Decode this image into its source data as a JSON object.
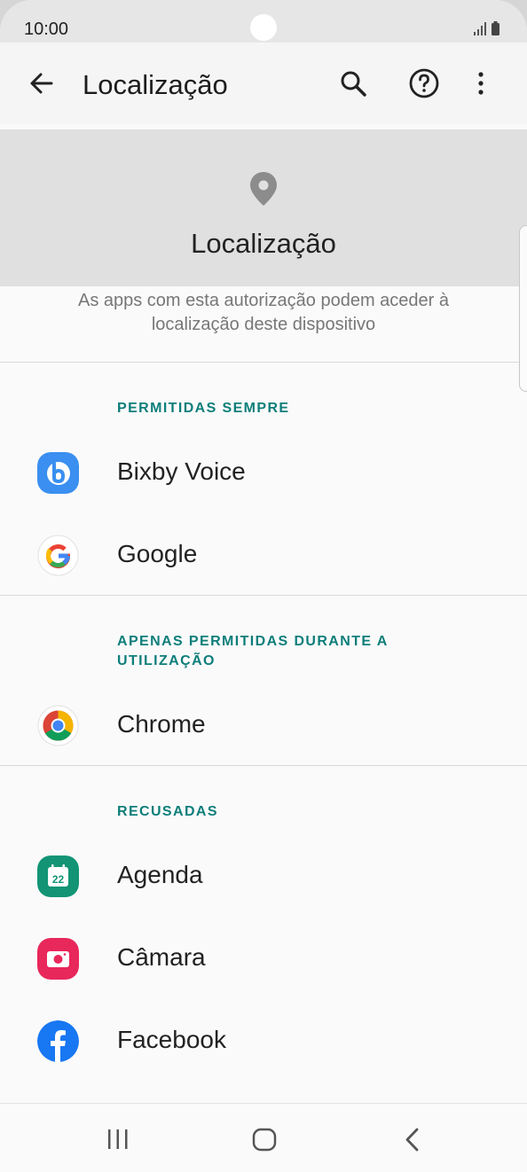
{
  "status_bar": {
    "time": "10:00"
  },
  "app_bar": {
    "title": "Localização"
  },
  "hero": {
    "title": "Localização"
  },
  "description": "As apps com esta autorização podem aceder à localização deste dispositivo",
  "sections": [
    {
      "title": "PERMITIDAS SEMPRE",
      "items": [
        {
          "label": "Bixby Voice",
          "icon": "bixby-icon"
        },
        {
          "label": "Google",
          "icon": "google-icon"
        }
      ]
    },
    {
      "title": "APENAS PERMITIDAS DURANTE A UTILIZAÇÃO",
      "items": [
        {
          "label": "Chrome",
          "icon": "chrome-icon"
        }
      ]
    },
    {
      "title": "RECUSADAS",
      "items": [
        {
          "label": "Agenda",
          "icon": "calendar-icon",
          "badge": "22"
        },
        {
          "label": "Câmara",
          "icon": "camera-icon"
        },
        {
          "label": "Facebook",
          "icon": "facebook-icon"
        }
      ]
    }
  ],
  "colors": {
    "accent": "#0d7e7a",
    "hero_bg": "#e0e0e0",
    "bixby": "#3a8ff0",
    "agenda": "#129475",
    "camera": "#e8275a",
    "facebook": "#1877f2"
  }
}
